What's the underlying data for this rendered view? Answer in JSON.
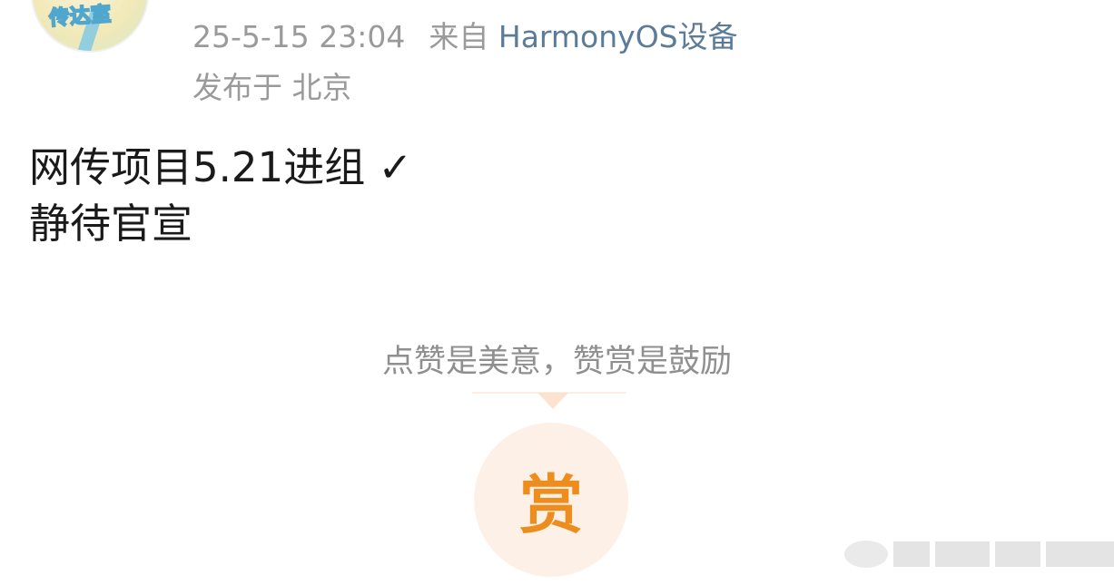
{
  "post": {
    "avatar_text": "传达室",
    "date_time": "25-5-15 23:04",
    "source_prefix": "来自",
    "source_device": "HarmonyOS设备",
    "location": "发布于 北京",
    "content_line1": "网传项目5.21进组 ✓",
    "content_line2": "静待官宣"
  },
  "reward": {
    "prompt": "点赞是美意，赞赏是鼓励",
    "button_char": "赏"
  },
  "colors": {
    "meta_gray": "#9a9a9a",
    "source_link": "#5b7c99",
    "content_text": "#1a1a1a",
    "reward_orange": "#ec8d1e",
    "reward_bg": "#fdf1e7"
  },
  "icons": {
    "watermark": "platform-watermark-icon"
  }
}
